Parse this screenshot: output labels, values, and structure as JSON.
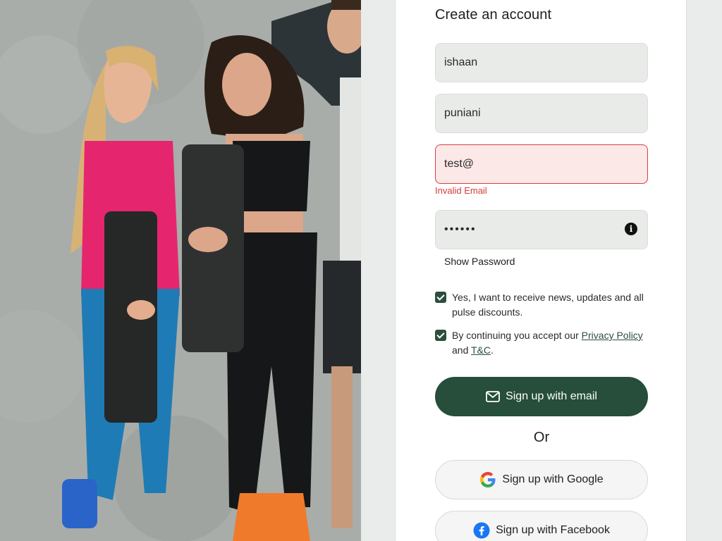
{
  "hero": {
    "image_alt": "people holding exercise mats"
  },
  "form": {
    "title": "Create an account",
    "first_name_value": "ishaan",
    "last_name_value": "puniani",
    "email_value": "test@",
    "email_error": "Invalid Email",
    "password_value": "••••••",
    "show_password_label": "Show Password",
    "info_icon": "info-icon",
    "newsletter_checked": true,
    "newsletter_text": "Yes, I want to receive news, updates and all pulse discounts.",
    "terms_checked": true,
    "terms_prefix": "By continuing you accept our ",
    "terms_privacy_link": "Privacy Policy",
    "terms_and": " and ",
    "terms_tc_link": "T&C",
    "terms_suffix": ".",
    "signup_email_label": "Sign up with email",
    "or_label": "Or",
    "signup_google_label": "Sign up with Google",
    "signup_facebook_label": "Sign up with Facebook"
  },
  "colors": {
    "primary": "#264e3a",
    "error": "#d23b3b",
    "error_bg": "#fde8e8",
    "input_bg": "#e9ebe9",
    "page_bg": "#e9ecea"
  }
}
